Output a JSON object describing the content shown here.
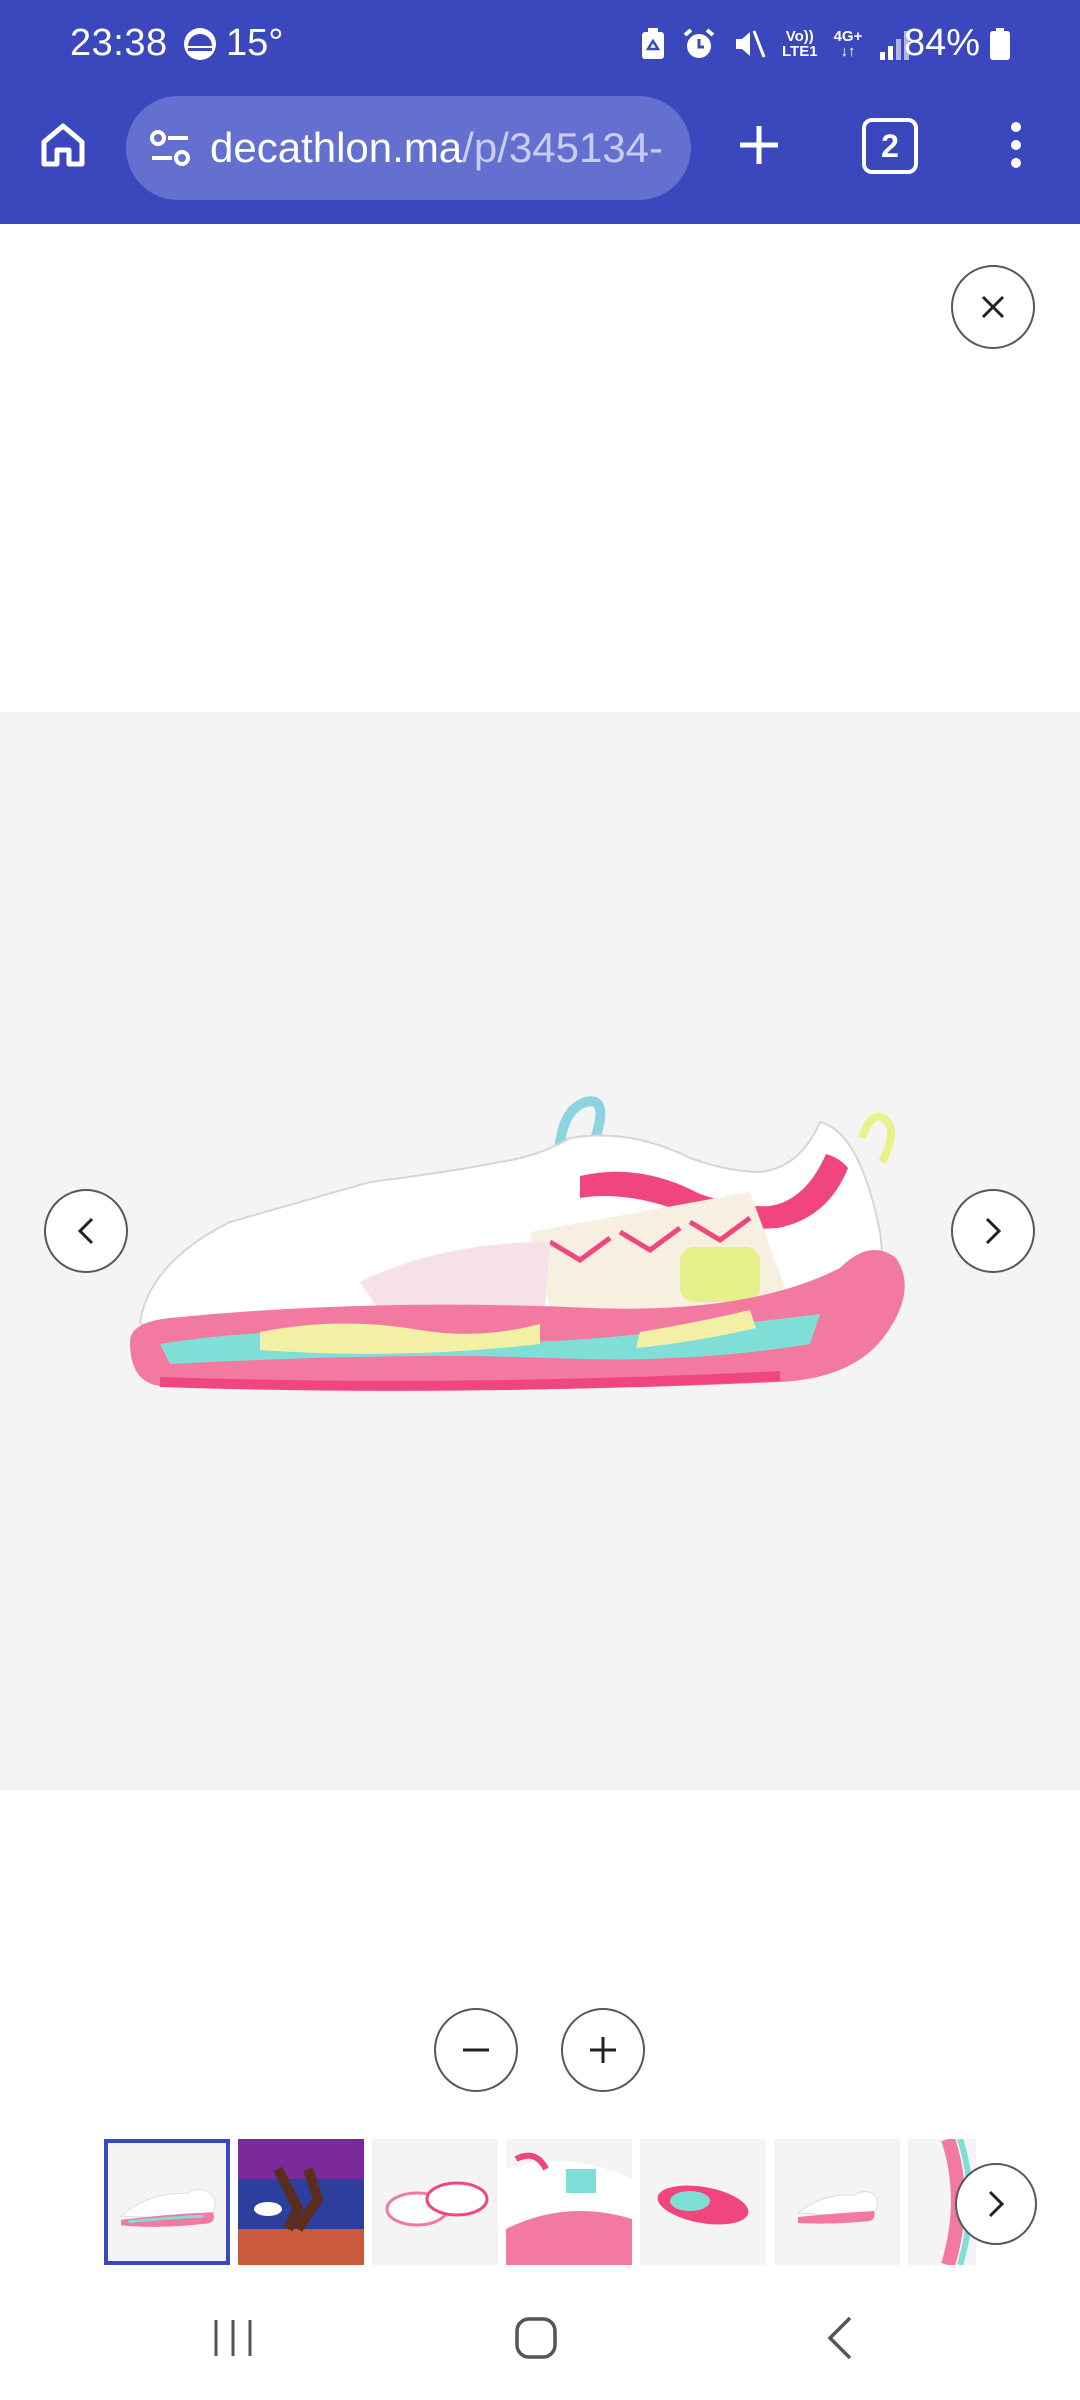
{
  "status_bar": {
    "time": "23:38",
    "temperature": "15°",
    "network_top": "Vo))",
    "network_bottom": "LTE1",
    "network_type": "4G+",
    "battery": "84%",
    "icons": [
      "weather-icon",
      "recycle-icon",
      "alarm-icon",
      "mute-icon",
      "signal-icon",
      "battery-icon"
    ]
  },
  "browser": {
    "url_domain": "decathlon.ma",
    "url_path": "/p/345134-",
    "tab_count": "2",
    "accent_color": "#3a47bd",
    "url_bar_color": "#6470d0"
  },
  "viewer": {
    "background_color": "#f4f4f4",
    "buttons": [
      "close-icon",
      "chevron-left-icon",
      "chevron-right-icon",
      "minus-icon",
      "plus-icon"
    ],
    "thumbnails": [
      {
        "label": "shoe-side-view",
        "active": true
      },
      {
        "label": "runner-on-track",
        "active": false
      },
      {
        "label": "shoe-pair-top",
        "active": false
      },
      {
        "label": "shoe-closeup",
        "active": false
      },
      {
        "label": "shoe-sole",
        "active": false
      },
      {
        "label": "shoe-side-small",
        "active": false
      },
      {
        "label": "shoe-partial",
        "active": false
      }
    ]
  },
  "system_nav": [
    "recents-icon",
    "home-icon",
    "back-icon"
  ]
}
